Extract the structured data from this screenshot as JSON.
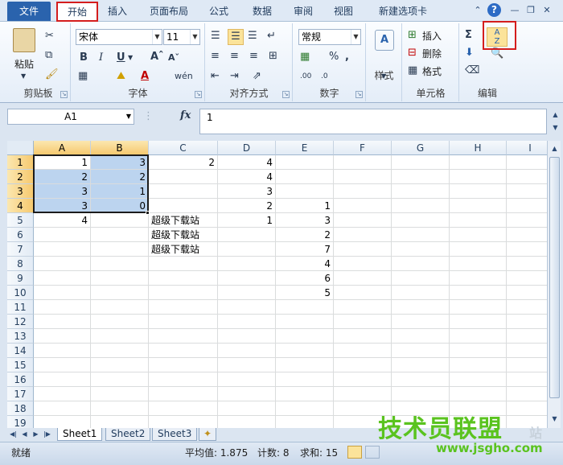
{
  "tabs": {
    "file": "文件",
    "home": "开始",
    "insert": "插入",
    "page_layout": "页面布局",
    "formulas": "公式",
    "data": "数据",
    "review": "审阅",
    "view": "视图",
    "new_tab": "新建选项卡"
  },
  "ribbon": {
    "clipboard": {
      "label": "剪贴板",
      "paste": "粘贴"
    },
    "font": {
      "label": "字体",
      "name": "宋体",
      "size": "11"
    },
    "alignment": {
      "label": "对齐方式"
    },
    "number": {
      "label": "数字",
      "format": "常规"
    },
    "styles": {
      "label": "样式"
    },
    "cells": {
      "label": "单元格",
      "insert": "插入",
      "delete": "删除",
      "format": "格式"
    },
    "editing": {
      "label": "编辑"
    }
  },
  "formula_bar": {
    "name_box": "A1",
    "fx": "fx",
    "value": "1"
  },
  "columns": [
    "A",
    "B",
    "C",
    "D",
    "E",
    "F",
    "G",
    "H",
    "I"
  ],
  "rows": [
    "1",
    "2",
    "3",
    "4",
    "5",
    "6",
    "7",
    "8",
    "9",
    "10",
    "11",
    "12",
    "13",
    "14",
    "15",
    "16",
    "17",
    "18",
    "19"
  ],
  "cells": {
    "A1": "1",
    "B1": "3",
    "C1": "2",
    "D1": "4",
    "A2": "2",
    "B2": "2",
    "D2": "4",
    "A3": "3",
    "B3": "1",
    "D3": "3",
    "A4": "3",
    "B4": "0",
    "D4": "2",
    "E4": "1",
    "A5": "4",
    "C5": "超级下载站",
    "D5": "1",
    "E5": "3",
    "C6": "超级下载站",
    "E6": "2",
    "C7": "超级下载站",
    "E7": "7",
    "E8": "4",
    "E9": "6",
    "E10": "5"
  },
  "sheets": [
    "Sheet1",
    "Sheet2",
    "Sheet3"
  ],
  "status": {
    "ready": "就绪",
    "average": "平均值: 1.875",
    "count": "计数: 8",
    "sum": "求和: 15"
  },
  "watermark": {
    "title": "技术员联盟",
    "url": "www.jsgho.com",
    "station": "站"
  },
  "colors": {
    "accent": "#2a63ad",
    "highlight": "#d41d1d",
    "selection": "#bcd4ef"
  }
}
